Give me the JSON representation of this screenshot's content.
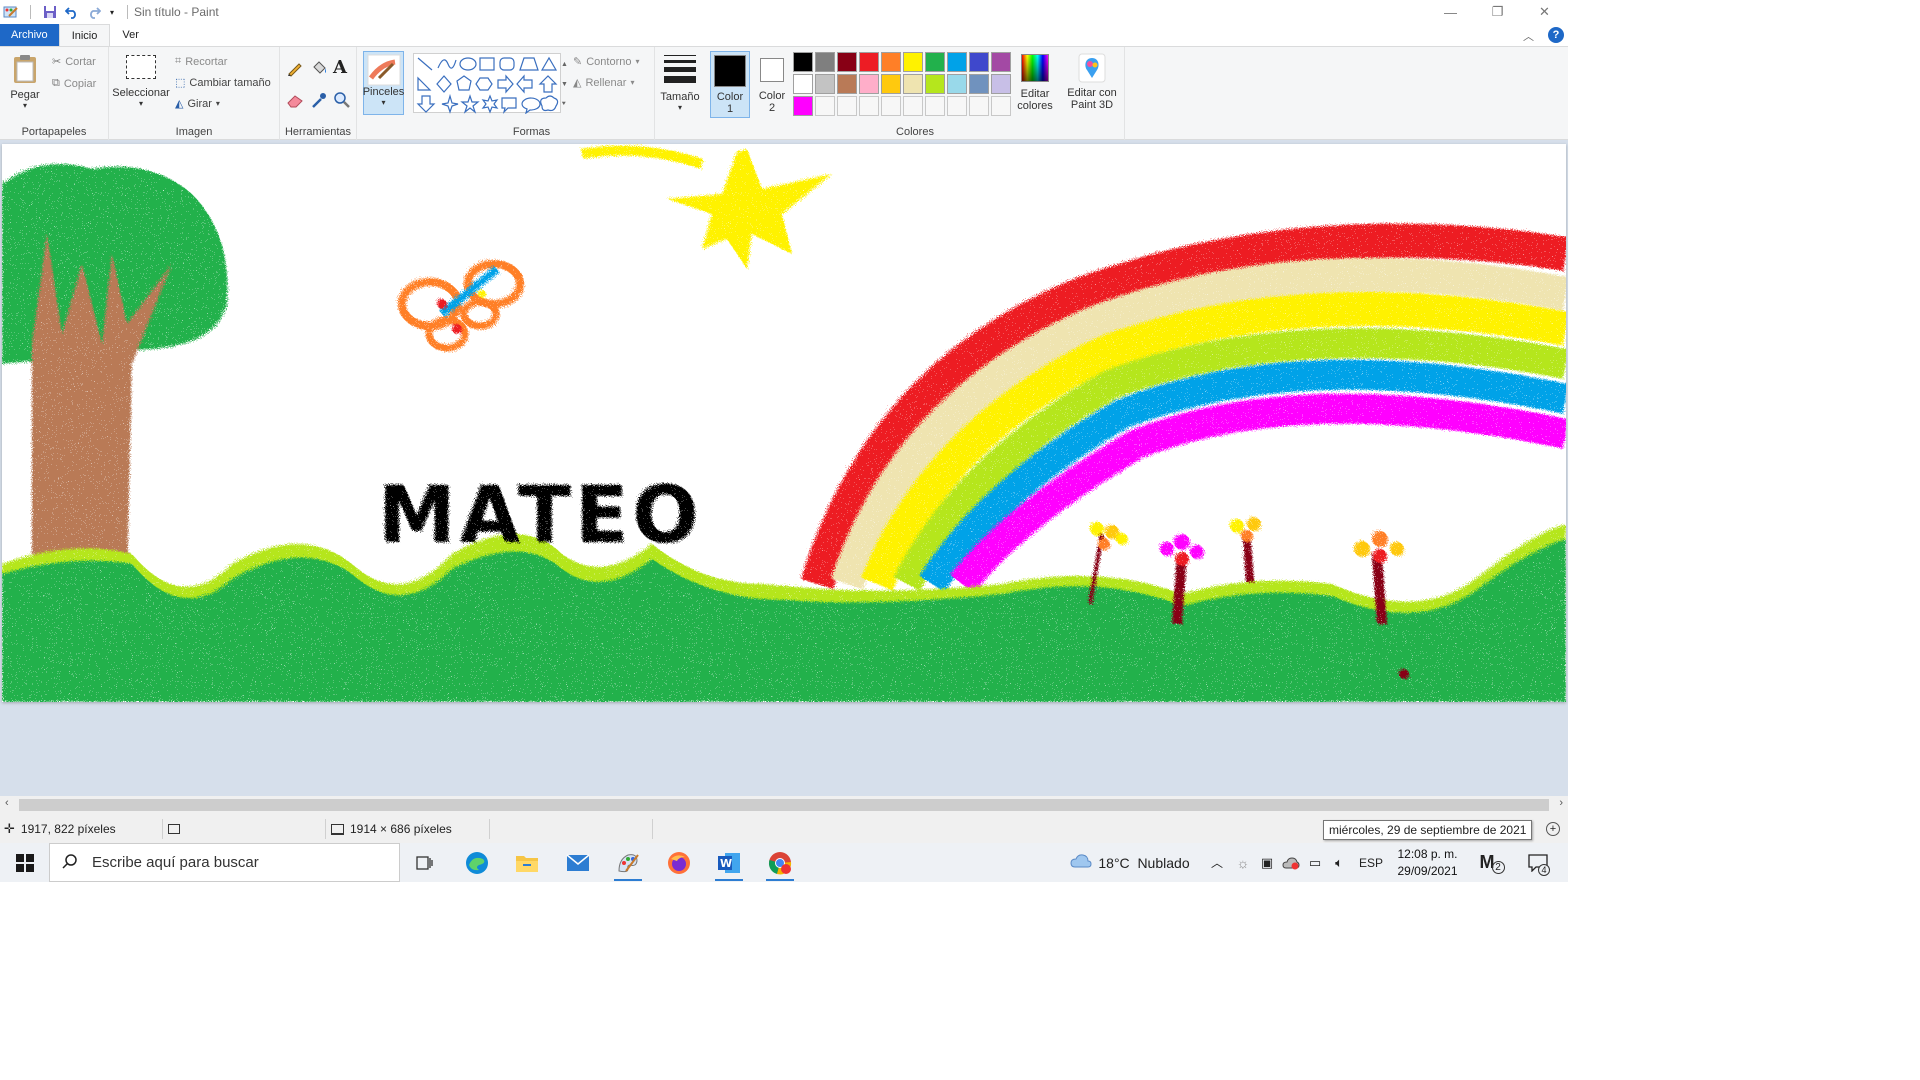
{
  "window": {
    "title": "Sin título - Paint",
    "controls": {
      "minimize": "—",
      "maximize": "❐",
      "close": "✕"
    }
  },
  "menu": {
    "file": "Archivo",
    "home": "Inicio",
    "view": "Ver"
  },
  "ribbon": {
    "clipboard": {
      "paste": "Pegar",
      "cut": "Cortar",
      "copy": "Copiar",
      "group": "Portapapeles"
    },
    "image": {
      "select": "Seleccionar",
      "crop": "Recortar",
      "resize": "Cambiar tamaño",
      "rotate": "Girar",
      "group": "Imagen"
    },
    "tools": {
      "group": "Herramientas"
    },
    "brushes": {
      "label": "Pinceles"
    },
    "shapes": {
      "outline": "Contorno",
      "fill": "Rellenar",
      "group": "Formas"
    },
    "size": {
      "label": "Tamaño"
    },
    "colors": {
      "color1_label": "Color",
      "color1_num": "1",
      "color2_label": "Color",
      "color2_num": "2",
      "edit_colors_1": "Editar",
      "edit_colors_2": "colores",
      "group": "Colores",
      "color1": "#000000",
      "color2": "#ffffff",
      "palette": [
        "#000000",
        "#7f7f7f",
        "#880015",
        "#ed1c24",
        "#ff7f27",
        "#fff200",
        "#22b14c",
        "#00a2e8",
        "#3f48cc",
        "#a349a4",
        "#ffffff",
        "#c3c3c3",
        "#b97a57",
        "#ffaec9",
        "#ffc90e",
        "#efe4b0",
        "#b5e61d",
        "#99d9ea",
        "#7092be",
        "#c8bfe7",
        "#ff00ff",
        "#f7f7f7",
        "#f7f7f7",
        "#f7f7f7",
        "#f7f7f7",
        "#f7f7f7",
        "#f7f7f7",
        "#f7f7f7",
        "#f7f7f7",
        "#f7f7f7"
      ]
    },
    "paint3d": {
      "line1": "Editar con",
      "line2": "Paint 3D"
    }
  },
  "canvas": {
    "text": "MATEO"
  },
  "status": {
    "cursor": "1917, 822 píxeles",
    "image_size": "1914 × 686 píxeles"
  },
  "tooltip": "miércoles, 29 de septiembre de 2021",
  "taskbar": {
    "search_placeholder": "Escribe aquí para buscar",
    "weather": "18°C  Nublado",
    "lang": "ESP",
    "time": "12:08 p. m.",
    "date": "29/09/2021",
    "notifications": "4",
    "app_badge": "2"
  }
}
